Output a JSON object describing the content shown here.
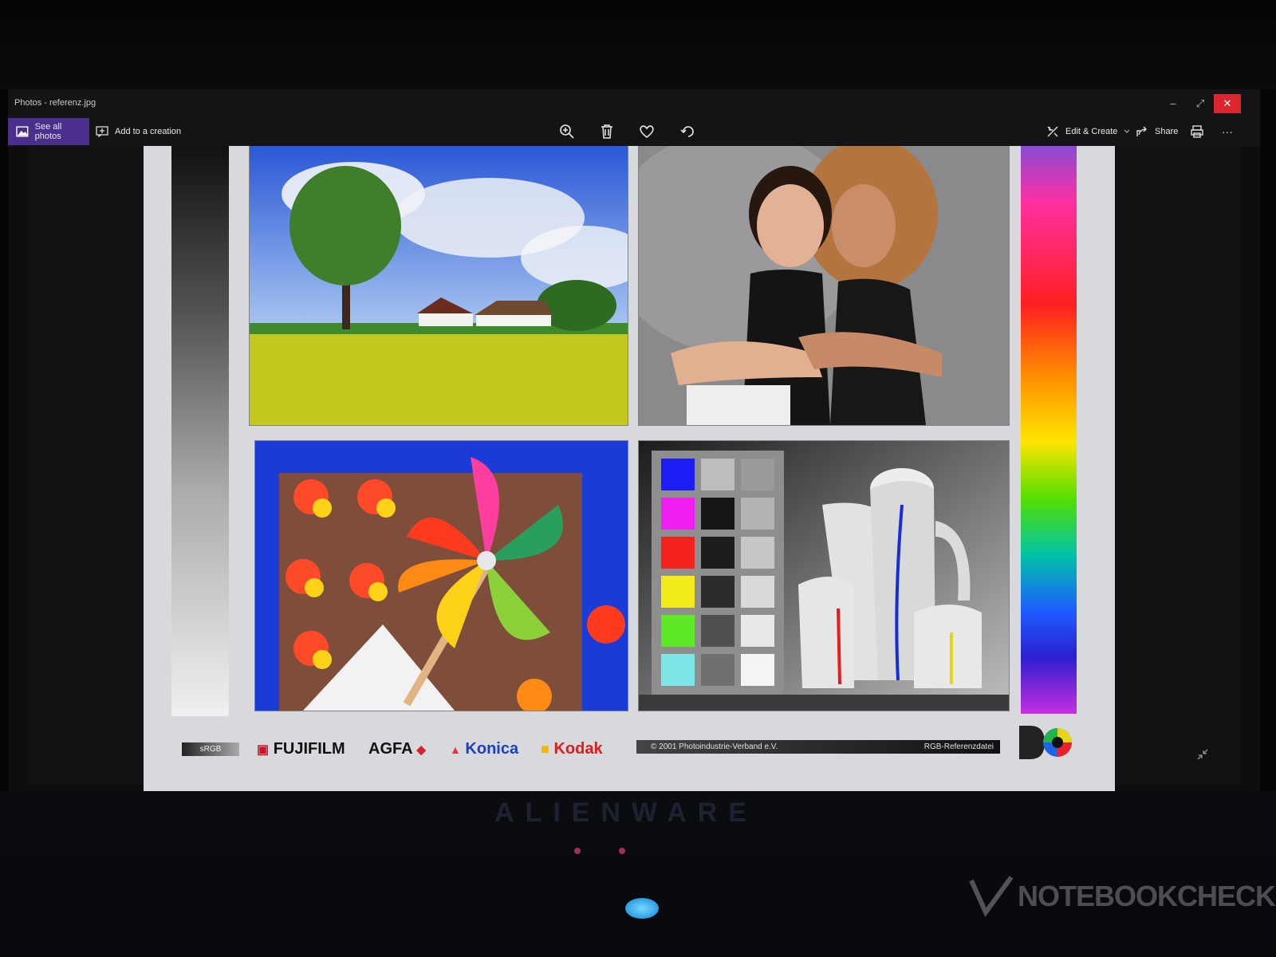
{
  "window": {
    "title": "Photos - referenz.jpg",
    "controls": {
      "minimize": "–",
      "restore": "⤢",
      "close": "✕"
    }
  },
  "toolbar": {
    "see_all_photos": "See all photos",
    "add_to_creation": "Add to a creation",
    "edit_create": "Edit & Create",
    "share": "Share",
    "more": "···"
  },
  "chart": {
    "srgb": "sRGB",
    "logos": [
      "FUJIFILM",
      "AGFA",
      "Konica",
      "Kodak"
    ],
    "copyright": "© 2001  Photoindustrie-Verband e.V.",
    "file_label": "RGB-Referenzdatei",
    "swatches": {
      "col1": [
        "#1d1df5",
        "#f01ef0",
        "#f4221c",
        "#f3ec1a",
        "#5fe826",
        "#7ee6e8"
      ],
      "col2": [
        "#bdbdbd",
        "#151515",
        "#1d1d1d",
        "#2b2b2b",
        "#505050",
        "#707070"
      ],
      "col3": [
        "#9a9a9a",
        "#b4b4b4",
        "#c7c7c7",
        "#dadada",
        "#e8e8e8",
        "#f4f4f4"
      ]
    }
  },
  "laptop": {
    "brand": "ALIENWARE"
  },
  "watermark": {
    "text": "NOTEBOOKCHECK"
  },
  "colors": {
    "accent": "#4b2f8c",
    "close": "#d9262f"
  }
}
